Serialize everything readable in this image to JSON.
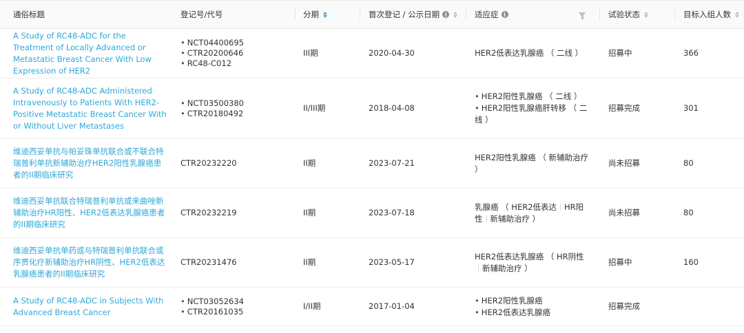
{
  "headers": {
    "title": "通俗标题",
    "reg": "登记号/代号",
    "phase": "分期",
    "date": "首次登记 / 公示日期",
    "indication": "适应症",
    "status": "试验状态",
    "target": "目标入组人数"
  },
  "rows": [
    {
      "title": "A Study of RC48-ADC for the Treatment of Locally Advanced or Metastatic Breast Cancer With Low Expression of HER2",
      "reg": [
        "NCT04400695",
        "CTR20200646",
        "RC48-C012"
      ],
      "phase": "III期",
      "date": "2020-04-30",
      "indication": [
        "HER2低表达乳腺癌 （ 二线 ）"
      ],
      "ind_bulleted": false,
      "status": "招募中",
      "target": "366"
    },
    {
      "title": "A Study of RC48-ADC Administered Intravenously to Patients With HER2-Positive Metastatic Breast Cancer With or Without Liver Metastases",
      "reg": [
        "NCT03500380",
        "CTR20180492"
      ],
      "phase": "II/III期",
      "date": "2018-04-08",
      "indication": [
        "HER2阳性乳腺癌 （ 二线 ）",
        "HER2阳性乳腺癌肝转移 （ 二线 ）"
      ],
      "ind_bulleted": true,
      "status": "招募完成",
      "target": "301"
    },
    {
      "title": "维迪西妥单抗与帕妥珠单抗联合或不联合特瑞普利单抗新辅助治疗HER2阳性乳腺癌患者的II期临床研究",
      "reg": [
        "CTR20232220"
      ],
      "phase": "II期",
      "date": "2023-07-21",
      "indication": [
        "HER2阳性乳腺癌 （ 新辅助治疗 ）"
      ],
      "ind_bulleted": false,
      "status": "尚未招募",
      "target": "80"
    },
    {
      "title": "维迪西妥单抗联合特瑞普利单抗或来曲唑新辅助治疗HR阳性、HER2低表达乳腺癌患者的II期临床研究",
      "reg": [
        "CTR20232219"
      ],
      "phase": "II期",
      "date": "2023-07-18",
      "indication": [
        "乳腺癌 （ HER2低表达",
        "HR阳性",
        "新辅助治疗 ）"
      ],
      "ind_bulleted": false,
      "ind_split": true,
      "status": "尚未招募",
      "target": "80"
    },
    {
      "title": "维迪西妥单抗单药或与特瑞普利单抗联合或序贯化疗新辅助治疗HR阴性、HER2低表达乳腺癌患者的II期临床研究",
      "reg": [
        "CTR20231476"
      ],
      "phase": "II期",
      "date": "2023-05-17",
      "indication": [
        "HER2低表达乳腺癌 （ HR阴性",
        "新辅助治疗 ）"
      ],
      "ind_bulleted": false,
      "ind_split": true,
      "status": "招募中",
      "target": "160"
    },
    {
      "title": "A Study of RC48-ADC in Subjects With Advanced Breast Cancer",
      "reg": [
        "NCT03052634",
        "CTR20161035"
      ],
      "phase": "I/II期",
      "date": "2017-01-04",
      "indication": [
        "HER2阳性乳腺癌",
        "HER2低表达乳腺癌"
      ],
      "ind_bulleted": true,
      "status": "招募完成",
      "target": ""
    }
  ]
}
